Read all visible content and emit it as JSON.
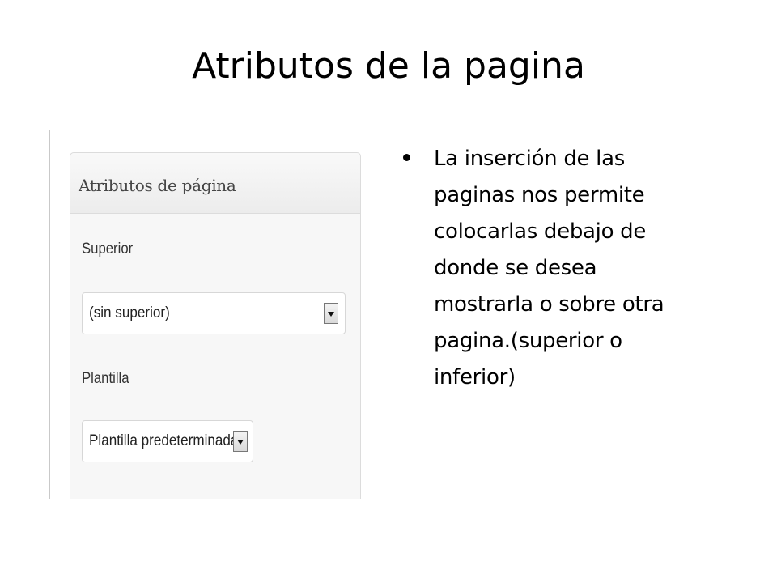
{
  "slide": {
    "title": "Atributos de la pagina",
    "bullet_text_lines": [
      "La inserción de las",
      "paginas nos permite",
      "colocarlas debajo de",
      "donde se desea",
      "mostrarla o sobre otra",
      "pagina.(superior o",
      "inferior)"
    ]
  },
  "screenshot": {
    "panel_title": "Atributos de página",
    "fields": [
      {
        "label": "Superior",
        "selected": "(sin superior)"
      },
      {
        "label": "Plantilla",
        "selected": "Plantilla predeterminada"
      }
    ],
    "icons": [
      "dropdown-arrow-icon"
    ]
  }
}
